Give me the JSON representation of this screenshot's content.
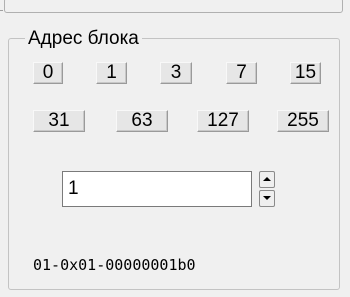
{
  "group": {
    "title": "Адрес блока"
  },
  "value_buttons": [
    {
      "label": "0"
    },
    {
      "label": "1"
    },
    {
      "label": "3"
    },
    {
      "label": "7"
    },
    {
      "label": "15"
    },
    {
      "label": "31"
    },
    {
      "label": "63"
    },
    {
      "label": "127"
    },
    {
      "label": "255"
    }
  ],
  "spinner": {
    "value": "1"
  },
  "address": {
    "text": "01-0x01-00000001b0"
  }
}
